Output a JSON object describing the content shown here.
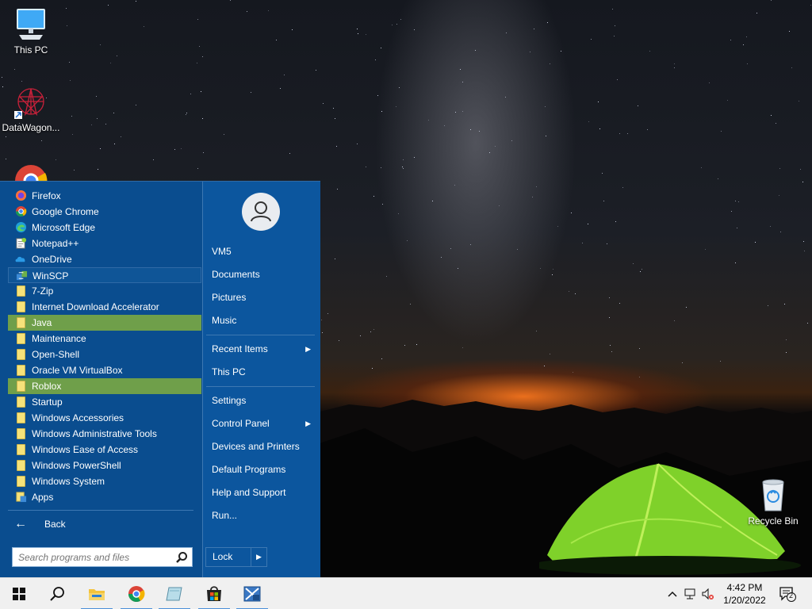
{
  "desktop": {
    "icons": [
      {
        "label": "This PC"
      },
      {
        "label": "DataWagon..."
      },
      {
        "label": "Recycle Bin"
      }
    ]
  },
  "start_menu": {
    "programs": [
      {
        "label": "Firefox",
        "icon": "firefox-icon"
      },
      {
        "label": "Google Chrome",
        "icon": "chrome-icon"
      },
      {
        "label": "Microsoft Edge",
        "icon": "edge-icon"
      },
      {
        "label": "Notepad++",
        "icon": "notepadpp-icon"
      },
      {
        "label": "OneDrive",
        "icon": "onedrive-icon"
      },
      {
        "label": "WinSCP",
        "icon": "winscp-icon"
      },
      {
        "label": "7-Zip",
        "icon": "folder-icon"
      },
      {
        "label": "Internet Download Accelerator",
        "icon": "folder-icon"
      },
      {
        "label": "Java",
        "icon": "folder-icon"
      },
      {
        "label": "Maintenance",
        "icon": "folder-icon"
      },
      {
        "label": "Open-Shell",
        "icon": "folder-icon"
      },
      {
        "label": "Oracle VM VirtualBox",
        "icon": "folder-icon"
      },
      {
        "label": "Roblox",
        "icon": "folder-icon"
      },
      {
        "label": "Startup",
        "icon": "folder-icon"
      },
      {
        "label": "Windows Accessories",
        "icon": "folder-icon"
      },
      {
        "label": "Windows Administrative Tools",
        "icon": "folder-icon"
      },
      {
        "label": "Windows Ease of Access",
        "icon": "folder-icon"
      },
      {
        "label": "Windows PowerShell",
        "icon": "folder-icon"
      },
      {
        "label": "Windows System",
        "icon": "folder-icon"
      },
      {
        "label": "Apps",
        "icon": "apps-icon"
      }
    ],
    "back_label": "Back",
    "search_placeholder": "Search programs and files",
    "right_items": {
      "user": "VM5",
      "documents": "Documents",
      "pictures": "Pictures",
      "music": "Music",
      "recent_items": "Recent Items",
      "this_pc": "This PC",
      "settings": "Settings",
      "control_panel": "Control Panel",
      "devices_printers": "Devices and Printers",
      "default_programs": "Default Programs",
      "help_support": "Help and Support",
      "run": "Run..."
    },
    "lock_label": "Lock",
    "colors": {
      "menu_bg": "#0a4d8f",
      "highlight": "#6f9f4a"
    }
  },
  "taskbar": {
    "time": "4:42 PM",
    "date": "1/20/2022",
    "notification_count": "2"
  }
}
